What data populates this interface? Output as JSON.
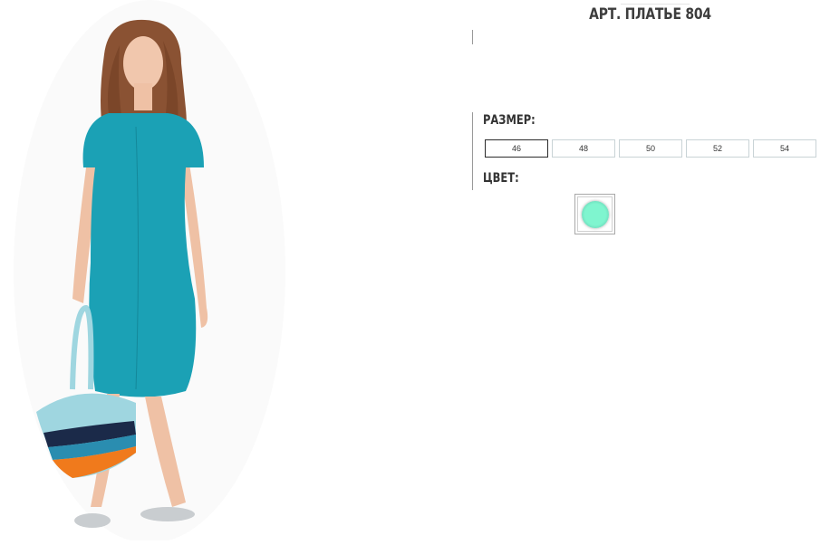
{
  "product": {
    "title": "АРТ. ПЛАТЬЕ 804",
    "photo_icon": "product-photo-dress-icon"
  },
  "size_section": {
    "label": "РАЗМЕР:",
    "options": [
      "46",
      "48",
      "50",
      "52",
      "54"
    ],
    "selected": "46"
  },
  "color_section": {
    "label": "ЦВЕТ:",
    "swatch_color": "#7ff5cf"
  },
  "colors": {
    "dress": "#1ba1b5",
    "hair": "#8a5233",
    "bag_light": "#9fd6e0",
    "bag_orange": "#f07a1c",
    "shoe": "#c9cdd0"
  }
}
